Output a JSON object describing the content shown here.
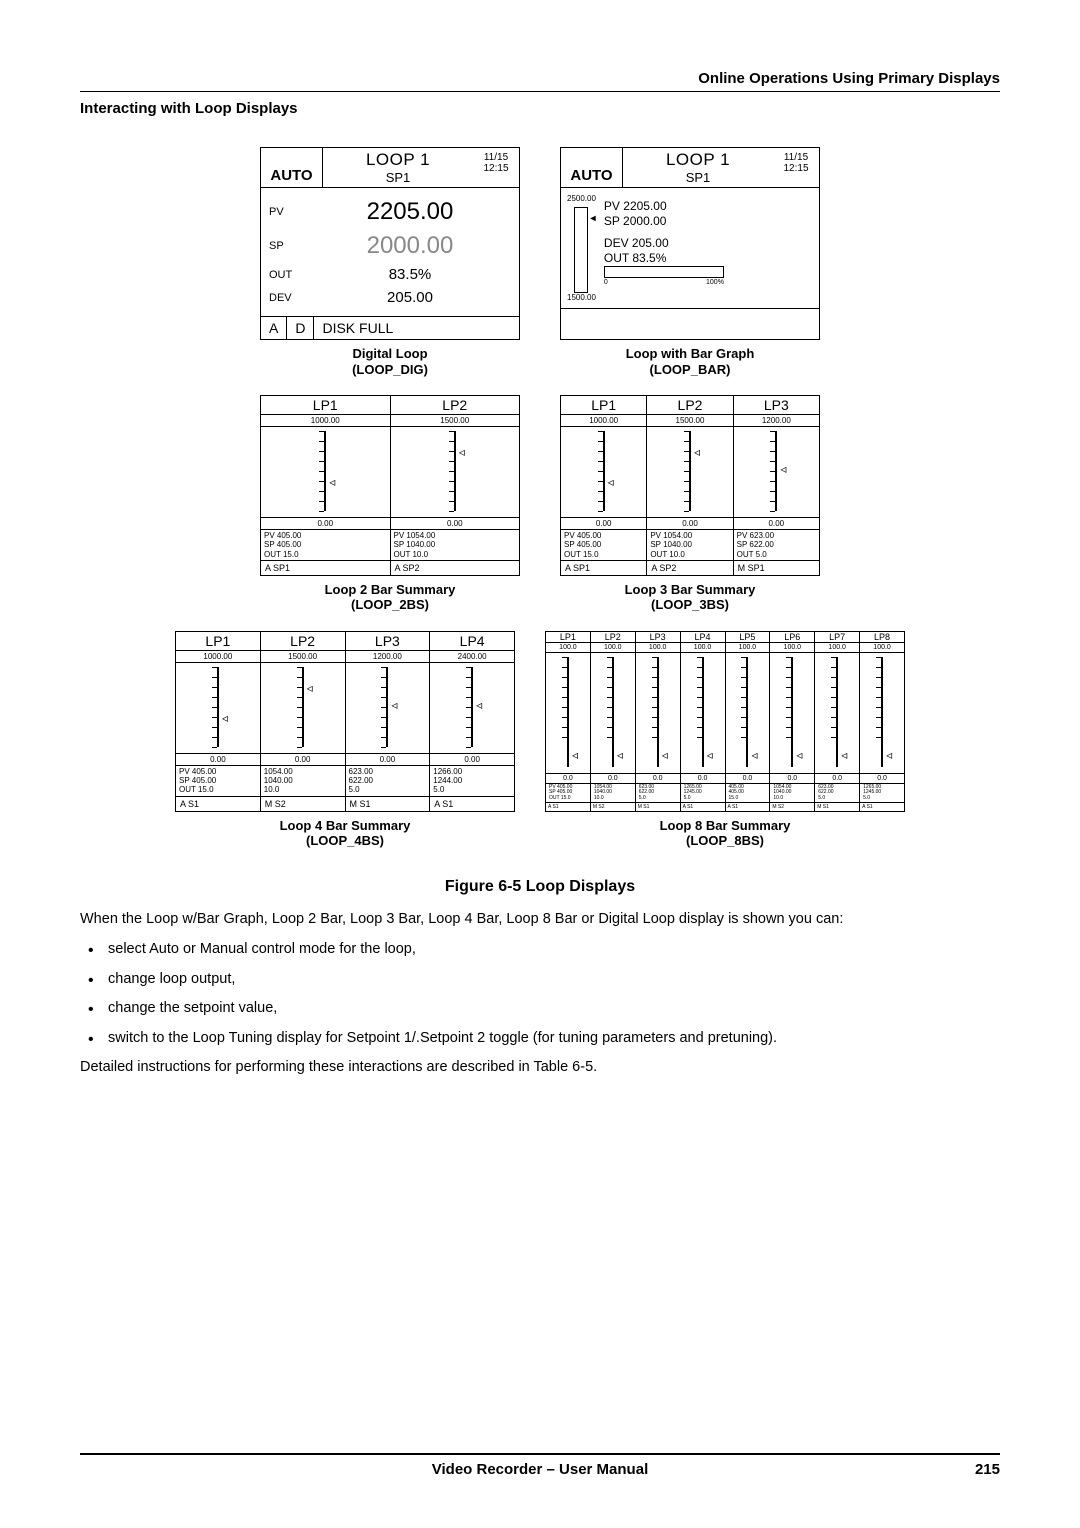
{
  "header": {
    "right": "Online Operations Using Primary Displays"
  },
  "section_title": "Interacting with Loop Displays",
  "digital": {
    "auto": "AUTO",
    "loop": "LOOP 1",
    "sp_lbl": "SP1",
    "date": "11/15",
    "time": "12:15",
    "rows": [
      {
        "lbl": "PV",
        "val": "2205.00",
        "cls": "big"
      },
      {
        "lbl": "SP",
        "val": "2000.00",
        "cls": "grey"
      },
      {
        "lbl": "OUT",
        "val": "83.5%",
        "cls": ""
      },
      {
        "lbl": "DEV",
        "val": "205.00",
        "cls": ""
      }
    ],
    "foot": [
      "A",
      "D",
      "DISK FULL"
    ],
    "caption1": "Digital Loop",
    "caption2": "(LOOP_DIG)"
  },
  "bargraph": {
    "auto": "AUTO",
    "loop": "LOOP 1",
    "sp_lbl": "SP1",
    "date": "11/15",
    "time": "12:15",
    "scale_hi": "2500.00",
    "scale_lo": "1500.00",
    "pv": "PV 2205.00",
    "sp": "SP 2000.00",
    "dev": "DEV 205.00",
    "out": "OUT 83.5%",
    "out_lo": "0",
    "out_hi": "100%",
    "caption1": "Loop with Bar Graph",
    "caption2": "(LOOP_BAR)"
  },
  "sum2": {
    "cols": [
      {
        "head": "LP1",
        "hi": "1000.00",
        "lo": "0.00",
        "pv": "PV   405.00",
        "sp": "SP   405.00",
        "out": "OUT   15.0",
        "mode": "A   SP1"
      },
      {
        "head": "LP2",
        "hi": "1500.00",
        "lo": "0.00",
        "pv": "PV  1054.00",
        "sp": "SP  1040.00",
        "out": "OUT   10.0",
        "mode": "A   SP2"
      }
    ],
    "caption1": "Loop 2 Bar Summary",
    "caption2": "(LOOP_2BS)"
  },
  "sum3": {
    "cols": [
      {
        "head": "LP1",
        "hi": "1000.00",
        "lo": "0.00",
        "pv": "PV   405.00",
        "sp": "SP   405.00",
        "out": "OUT   15.0",
        "mode": "A   SP1"
      },
      {
        "head": "LP2",
        "hi": "1500.00",
        "lo": "0.00",
        "pv": "PV  1054.00",
        "sp": "SP  1040.00",
        "out": "OUT   10.0",
        "mode": "A   SP2"
      },
      {
        "head": "LP3",
        "hi": "1200.00",
        "lo": "0.00",
        "pv": "PV   623.00",
        "sp": "SP   622.00",
        "out": "OUT    5.0",
        "mode": "M   SP1"
      }
    ],
    "caption1": "Loop 3 Bar Summary",
    "caption2": "(LOOP_3BS)"
  },
  "sum4": {
    "cols": [
      {
        "head": "LP1",
        "hi": "1000.00",
        "lo": "0.00",
        "pv": "PV   405.00",
        "sp": "SP   405.00",
        "out": "OUT   15.0",
        "mode": "A   S1"
      },
      {
        "head": "LP2",
        "hi": "1500.00",
        "lo": "0.00",
        "pv": "1054.00",
        "sp": "1040.00",
        "out": "10.0",
        "mode": "M   S2"
      },
      {
        "head": "LP3",
        "hi": "1200.00",
        "lo": "0.00",
        "pv": "623.00",
        "sp": "622.00",
        "out": "5.0",
        "mode": "M   S1"
      },
      {
        "head": "LP4",
        "hi": "2400.00",
        "lo": "0.00",
        "pv": "1266.00",
        "sp": "1244.00",
        "out": "5.0",
        "mode": "A   S1"
      }
    ],
    "caption1": "Loop 4 Bar Summary",
    "caption2": "(LOOP_4BS)"
  },
  "sum8": {
    "cols": [
      {
        "head": "LP1",
        "hi": "100.0",
        "lo": "0.0",
        "pv": "PV 405.00",
        "sp": "SP 405.00",
        "out": "OUT 15.0",
        "mode": "A  S1"
      },
      {
        "head": "LP2",
        "hi": "100.0",
        "lo": "0.0",
        "pv": "1054.00",
        "sp": "1040.00",
        "out": "10.0",
        "mode": "M  S2"
      },
      {
        "head": "LP3",
        "hi": "100.0",
        "lo": "0.0",
        "pv": "623.00",
        "sp": "622.00",
        "out": "5.0",
        "mode": "M  S1"
      },
      {
        "head": "LP4",
        "hi": "100.0",
        "lo": "0.0",
        "pv": "1265.00",
        "sp": "1245.00",
        "out": "5.0",
        "mode": "A  S1"
      },
      {
        "head": "LP5",
        "hi": "100.0",
        "lo": "0.0",
        "pv": "405.00",
        "sp": "405.00",
        "out": "15.0",
        "mode": "A  S1"
      },
      {
        "head": "LP6",
        "hi": "100.0",
        "lo": "0.0",
        "pv": "1054.00",
        "sp": "1040.00",
        "out": "10.0",
        "mode": "M  S2"
      },
      {
        "head": "LP7",
        "hi": "100.0",
        "lo": "0.0",
        "pv": "623.00",
        "sp": "622.00",
        "out": "5.0",
        "mode": "M  S1"
      },
      {
        "head": "LP8",
        "hi": "100.0",
        "lo": "0.0",
        "pv": "1265.00",
        "sp": "1245.00",
        "out": "5.0",
        "mode": "A  S1"
      }
    ],
    "caption1": "Loop 8 Bar Summary",
    "caption2": "(LOOP_8BS)"
  },
  "figure_caption": "Figure 6-5  Loop Displays",
  "para1": "When the Loop w/Bar Graph, Loop 2 Bar, Loop 3 Bar, Loop 4 Bar, Loop 8 Bar or Digital Loop display is shown you can:",
  "bullets": [
    "select Auto or Manual control mode for the loop,",
    "change loop output,",
    "change the setpoint value,",
    "switch to the Loop Tuning display for Setpoint 1/.Setpoint 2 toggle (for tuning parameters and pretuning)."
  ],
  "para2": "Detailed instructions for performing these interactions are described in Table 6-5.",
  "footer": {
    "center": "Video Recorder – User Manual",
    "page": "215"
  }
}
